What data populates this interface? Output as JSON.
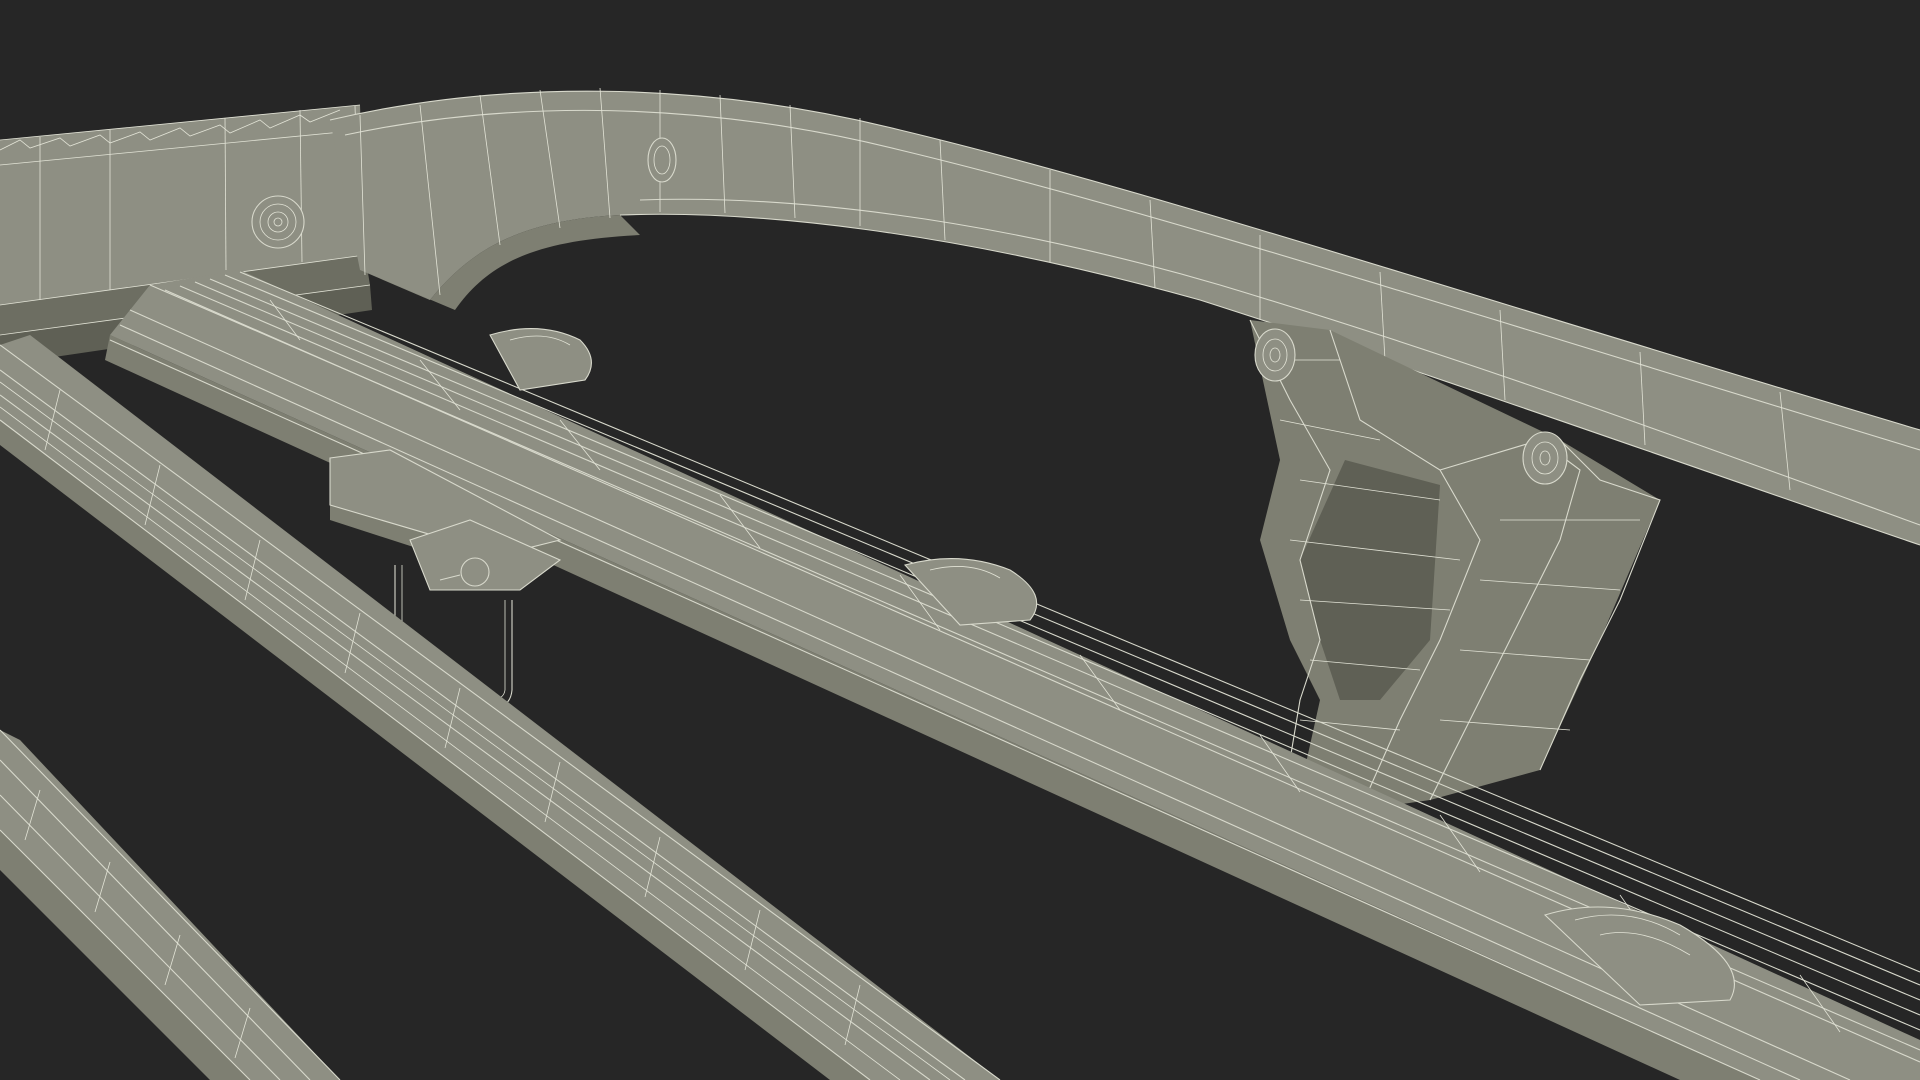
{
  "scene": {
    "subject": "leaf-spring-chassis-wireframe",
    "background_color": "#262626",
    "surface_color": "#7e7f72",
    "wire_color": "#d8d9cc"
  },
  "icons": {
    "bolt": "bolt-icon",
    "u_bolt": "u-bolt-icon",
    "bracket": "spring-hanger-icon"
  }
}
